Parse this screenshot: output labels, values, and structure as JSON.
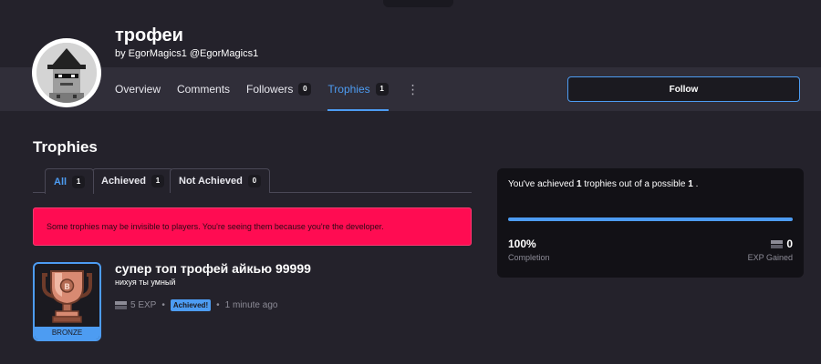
{
  "profile": {
    "title": "трофеи",
    "by_word": "by",
    "display_name": "EgorMagics1",
    "handle": "@EgorMagics1"
  },
  "nav": {
    "tabs": [
      {
        "label": "Overview"
      },
      {
        "label": "Comments"
      },
      {
        "label": "Followers",
        "count": "0"
      },
      {
        "label": "Trophies",
        "count": "1"
      }
    ],
    "active_tab": "Trophies",
    "more_glyph": "⋮"
  },
  "follow_button": {
    "label": "Follow"
  },
  "trophies": {
    "heading": "Trophies",
    "filters": [
      {
        "label": "All",
        "count": "1"
      },
      {
        "label": "Achieved",
        "count": "1"
      },
      {
        "label": "Not Achieved",
        "count": "0"
      }
    ],
    "active_filter": "All",
    "alert": "Some trophies may be invisible to players. You're seeing them because you're the developer.",
    "items": [
      {
        "name": "супер топ трофей айкью 99999",
        "description": "нихуя ты умный",
        "exp": "5 EXP",
        "status": "Achieved!",
        "time": "1 minute ago",
        "rank": "BRONZE",
        "icon": "bronze-trophy-icon"
      }
    ]
  },
  "summary": {
    "text_prefix": "You've achieved ",
    "achieved": "1",
    "text_middle": " trophies out of a possible ",
    "possible": "1",
    "text_suffix": " .",
    "completion_value": "100%",
    "completion_fraction": 1.0,
    "completion_label": "Completion",
    "exp_value": "0",
    "exp_label": "EXP Gained"
  },
  "colors": {
    "accent": "#4d9cf2",
    "alert": "#ff0c52",
    "background": "#24222b"
  }
}
